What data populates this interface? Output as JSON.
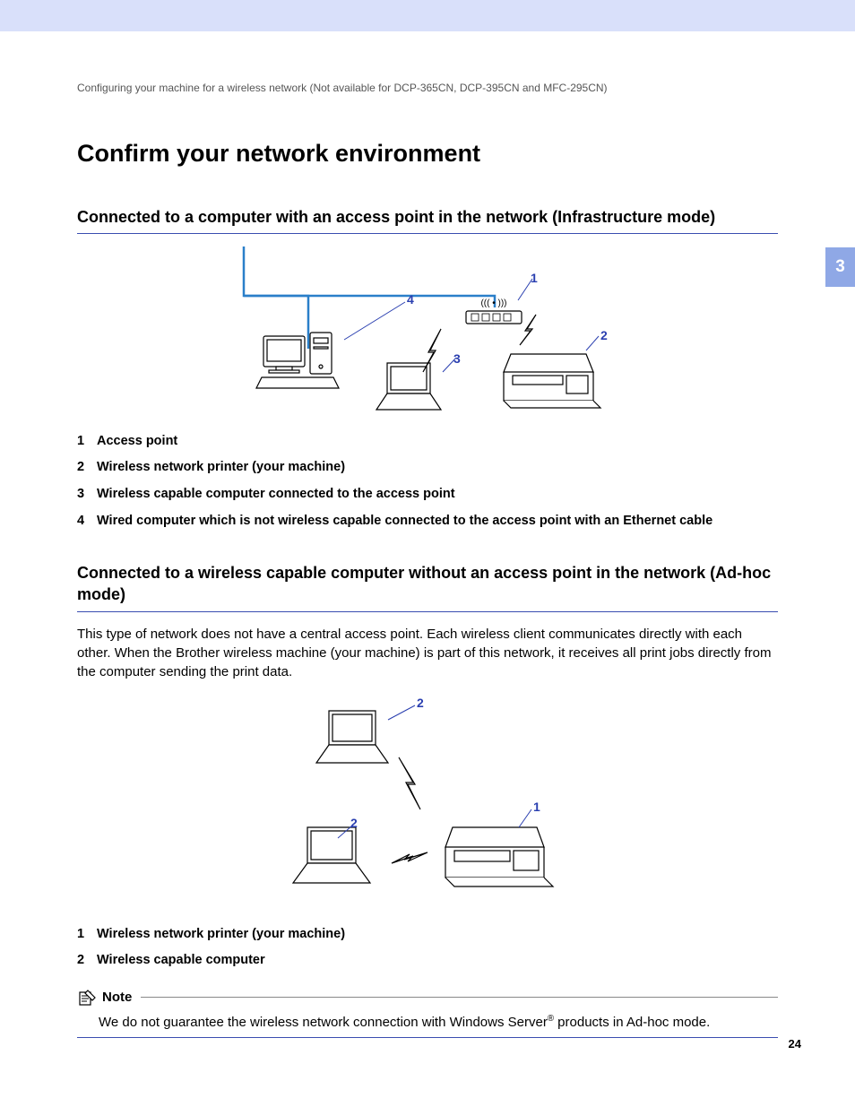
{
  "breadcrumb": "Configuring your machine for a wireless network (Not available for DCP-365CN, DCP-395CN and MFC-295CN)",
  "chapter_tab": "3",
  "h1": "Confirm your network environment",
  "section1": {
    "heading": "Connected to a computer with an access point in the network (Infrastructure mode)",
    "callouts": {
      "c1": "1",
      "c2": "2",
      "c3": "3",
      "c4": "4"
    },
    "legend": [
      {
        "n": "1",
        "t": "Access point"
      },
      {
        "n": "2",
        "t": "Wireless network printer (your machine)"
      },
      {
        "n": "3",
        "t": "Wireless capable computer connected to the access point"
      },
      {
        "n": "4",
        "t": "Wired computer which is not wireless capable connected to the access point with an Ethernet cable"
      }
    ]
  },
  "section2": {
    "heading": "Connected to a wireless capable computer without an access point in the network (Ad-hoc mode)",
    "para": "This type of network does not have a central access point. Each wireless client communicates directly with each other. When the Brother wireless machine (your machine) is part of this network, it receives all print jobs directly from the computer sending the print data.",
    "callouts": {
      "c1": "1",
      "c2a": "2",
      "c2b": "2"
    },
    "legend": [
      {
        "n": "1",
        "t": "Wireless network printer (your machine)"
      },
      {
        "n": "2",
        "t": "Wireless capable computer"
      }
    ]
  },
  "note": {
    "label": "Note",
    "body_pre": "We do not guarantee the wireless network connection with Windows Server",
    "body_sup": "®",
    "body_post": " products in Ad-hoc mode."
  },
  "page_number": "24"
}
